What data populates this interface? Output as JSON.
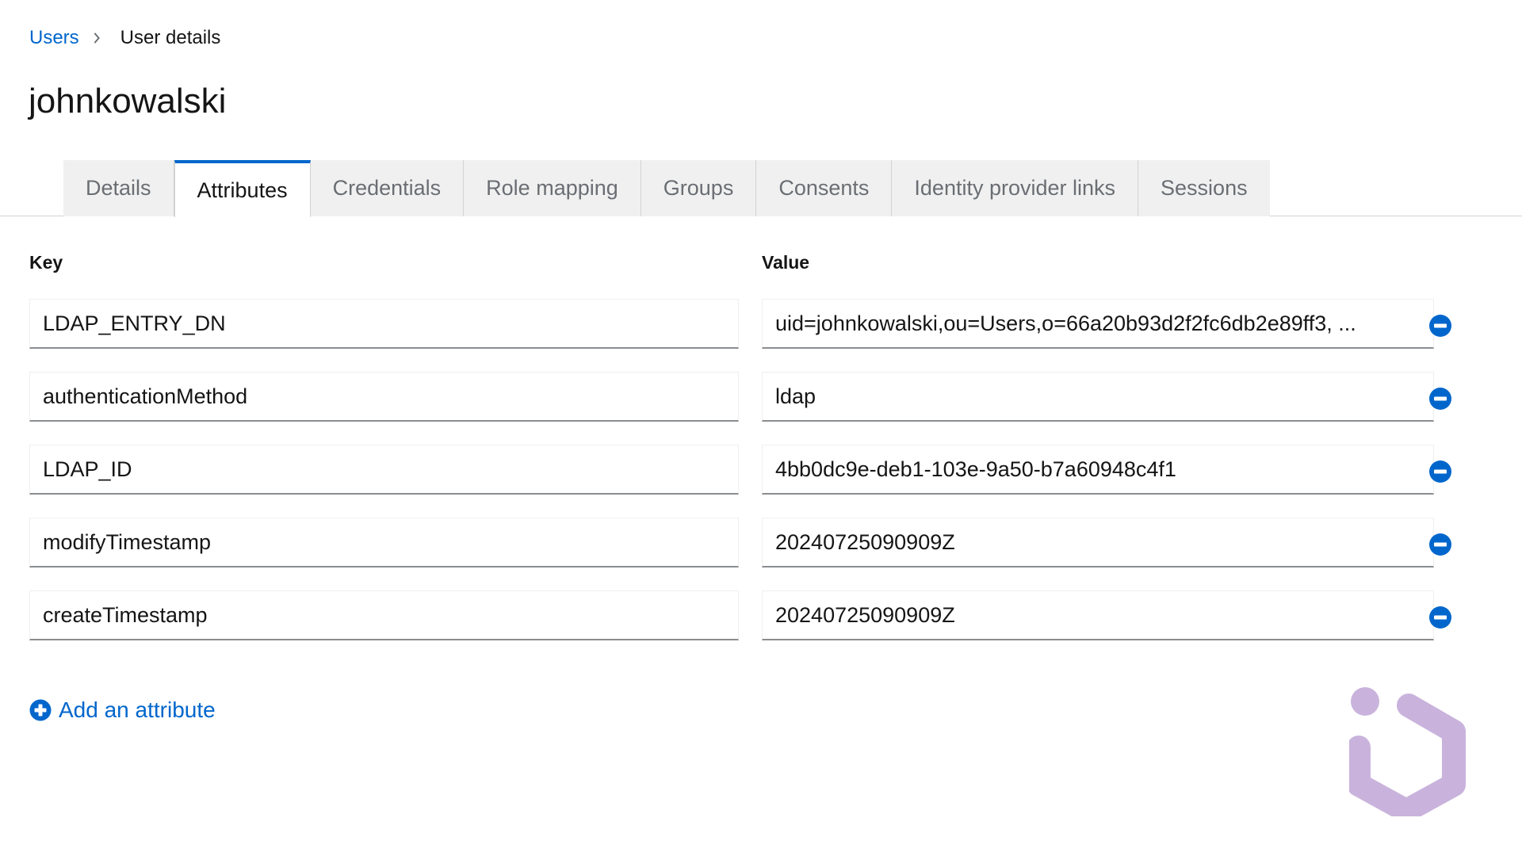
{
  "breadcrumb": {
    "parent": "Users",
    "current": "User details"
  },
  "page_title": "johnkowalski",
  "tabs": [
    {
      "label": "Details",
      "active": false
    },
    {
      "label": "Attributes",
      "active": true
    },
    {
      "label": "Credentials",
      "active": false
    },
    {
      "label": "Role mapping",
      "active": false
    },
    {
      "label": "Groups",
      "active": false
    },
    {
      "label": "Consents",
      "active": false
    },
    {
      "label": "Identity provider links",
      "active": false
    },
    {
      "label": "Sessions",
      "active": false
    }
  ],
  "attributes": {
    "key_header": "Key",
    "value_header": "Value",
    "rows": [
      {
        "key": "LDAP_ENTRY_DN",
        "value": "uid=johnkowalski,ou=Users,o=66a20b93d2f2fc6db2e89ff3, ..."
      },
      {
        "key": "authenticationMethod",
        "value": "ldap"
      },
      {
        "key": "LDAP_ID",
        "value": "4bb0dc9e-deb1-103e-9a50-b7a60948c4f1"
      },
      {
        "key": "modifyTimestamp",
        "value": "20240725090909Z"
      },
      {
        "key": "createTimestamp",
        "value": "20240725090909Z"
      }
    ],
    "add_label": "Add an attribute"
  },
  "icons": {
    "breadcrumb_separator": "chevron-right-icon",
    "remove": "minus-circle-icon",
    "add": "plus-circle-icon",
    "watermark": "logo-icon"
  },
  "colors": {
    "link": "#0066cc",
    "active_tab_border": "#0066cc",
    "watermark": "#c9b3dc"
  }
}
